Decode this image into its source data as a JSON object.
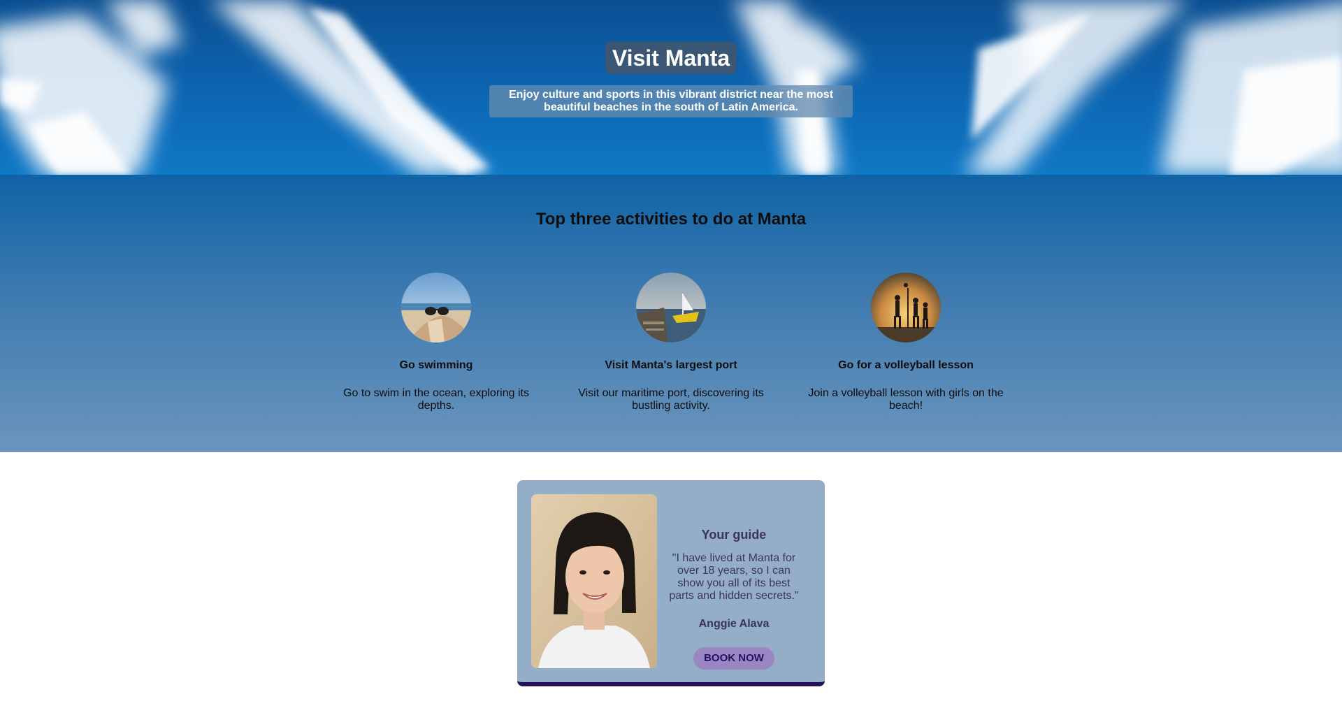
{
  "hero": {
    "title": "Visit Manta",
    "subtitle": "Enjoy culture and sports in this vibrant district near the most beautiful beaches in the south of Latin America."
  },
  "activities": {
    "heading": "Top three activities to do at Manta",
    "items": [
      {
        "title": "Go swimming",
        "description": "Go to swim in the ocean, exploring its depths.",
        "image": "beach-sunglasses-photo"
      },
      {
        "title": "Visit Manta's largest port",
        "description": "Visit our maritime port, discovering its bustling activity.",
        "image": "harbor-boat-photo"
      },
      {
        "title": "Go for a volleyball lesson",
        "description": "Join a volleyball lesson with girls on the beach!",
        "image": "beach-volleyball-sunset-photo"
      }
    ]
  },
  "guide": {
    "heading": "Your guide",
    "quote": "\"I have lived at Manta for over 18 years, so I can show you all of its best parts and hidden secrets.\"",
    "name": "Anggie Alava",
    "button_label": "BOOK NOW",
    "photo": "guide-portrait-photo"
  },
  "colors": {
    "hero_sky": "#0d66b3",
    "card_background": "#95aec7",
    "card_border": "#230f5a",
    "button_background": "#9a86c2",
    "button_text": "#24115e"
  }
}
